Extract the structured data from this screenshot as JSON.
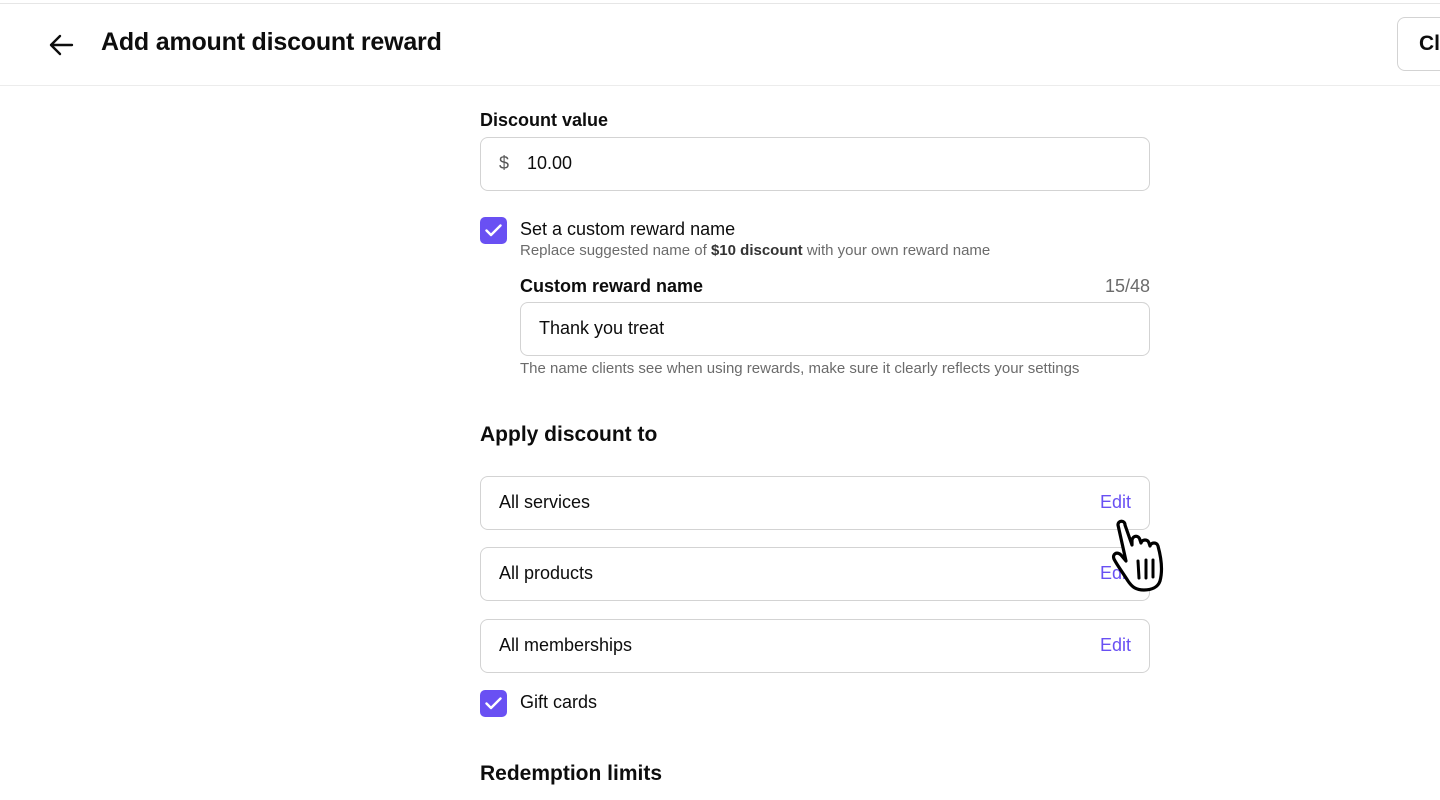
{
  "header": {
    "title": "Add amount discount reward",
    "back_icon": "arrow-left-icon",
    "close_label": "Clo"
  },
  "discount_value": {
    "label": "Discount value",
    "currency_symbol": "$",
    "value": "10.00"
  },
  "custom_name": {
    "checkbox_label": "Set a custom reward name",
    "checked": true,
    "hint_prefix": "Replace suggested name of ",
    "hint_bold": "$10 discount",
    "hint_suffix": " with your own reward name",
    "field_label": "Custom reward name",
    "counter": "15/48",
    "value": "Thank you treat",
    "helper": "The name clients see when using rewards, make sure it clearly reflects your settings"
  },
  "apply_to": {
    "title": "Apply discount to",
    "rows": [
      {
        "label": "All services",
        "action": "Edit"
      },
      {
        "label": "All products",
        "action": "Edit"
      },
      {
        "label": "All memberships",
        "action": "Edit"
      }
    ],
    "gift_cards_label": "Gift cards",
    "gift_cards_checked": true
  },
  "redemption": {
    "title": "Redemption limits"
  },
  "colors": {
    "accent": "#6950f3",
    "border": "#d3d3d3",
    "muted_text": "#6b6b6b"
  }
}
